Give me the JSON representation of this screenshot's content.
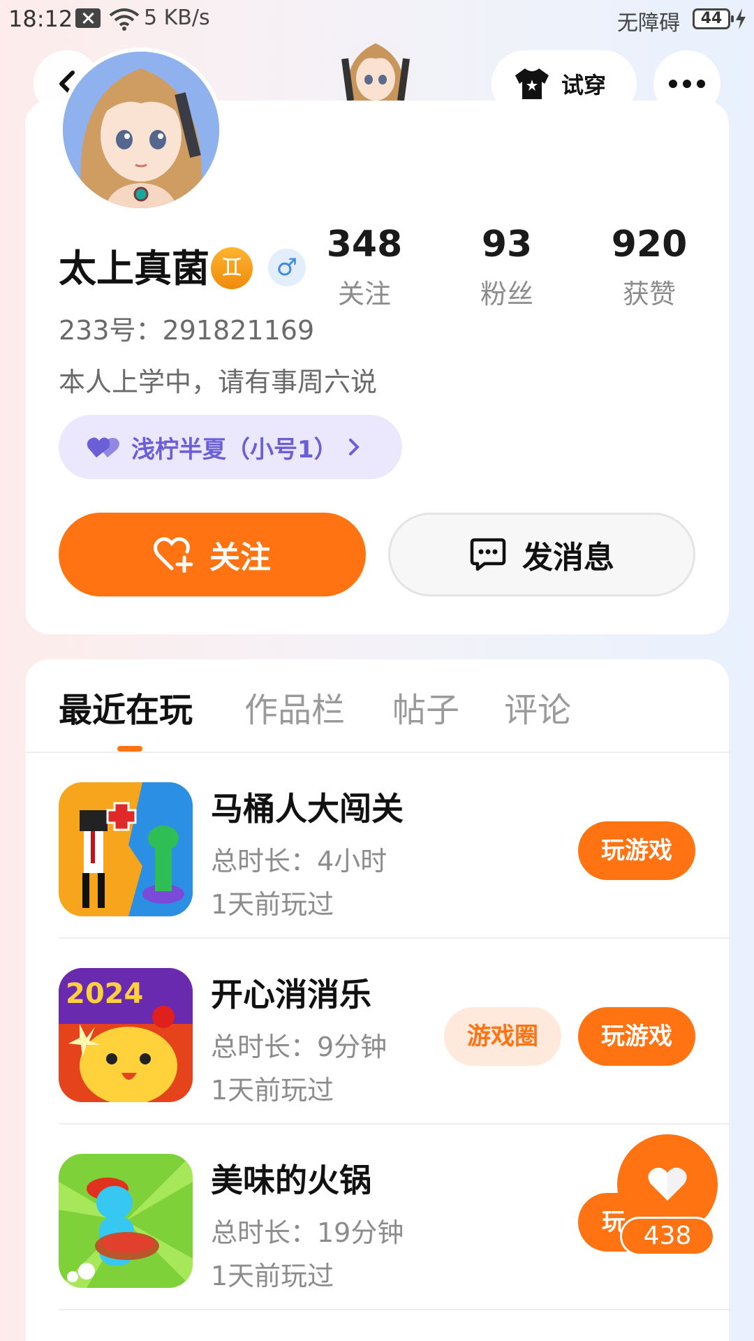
{
  "status_bar": {
    "time": "18:12",
    "network_speed": "5 KB/s",
    "accessibility": "无障碍",
    "battery": "44"
  },
  "top_bar": {
    "try_on_label": "试穿"
  },
  "profile": {
    "stats": [
      {
        "value": "348",
        "label": "关注"
      },
      {
        "value": "93",
        "label": "粉丝"
      },
      {
        "value": "920",
        "label": "获赞"
      }
    ],
    "name": "太上真菌",
    "zodiac_symbol": "♊",
    "gender_symbol": "♂",
    "user_id": "233号：291821169",
    "bio": "本人上学中，请有事周六说",
    "alt_account": "浅柠半夏（小号1）",
    "follow_label": "关注",
    "message_label": "发消息"
  },
  "tabs": [
    {
      "label": "最近在玩",
      "active": true
    },
    {
      "label": "作品栏",
      "active": false
    },
    {
      "label": "帖子",
      "active": false
    },
    {
      "label": "评论",
      "active": false
    }
  ],
  "games": [
    {
      "title": "马桶人大闯关",
      "duration": "总时长：4小时",
      "last_played": "1天前玩过",
      "play_label": "玩游戏",
      "circle_label": ""
    },
    {
      "title": "开心消消乐",
      "duration": "总时长：9分钟",
      "last_played": "1天前玩过",
      "play_label": "玩游戏",
      "circle_label": "游戏圈"
    },
    {
      "title": "美味的火锅",
      "duration": "总时长：19分钟",
      "last_played": "1天前玩过",
      "play_label": "玩",
      "circle_label": ""
    }
  ],
  "like_fab": {
    "count": "438"
  },
  "colors": {
    "accent": "#ff7313",
    "alt_account_bg": "#ebe8fd",
    "alt_account_text": "#6b5fd8"
  }
}
